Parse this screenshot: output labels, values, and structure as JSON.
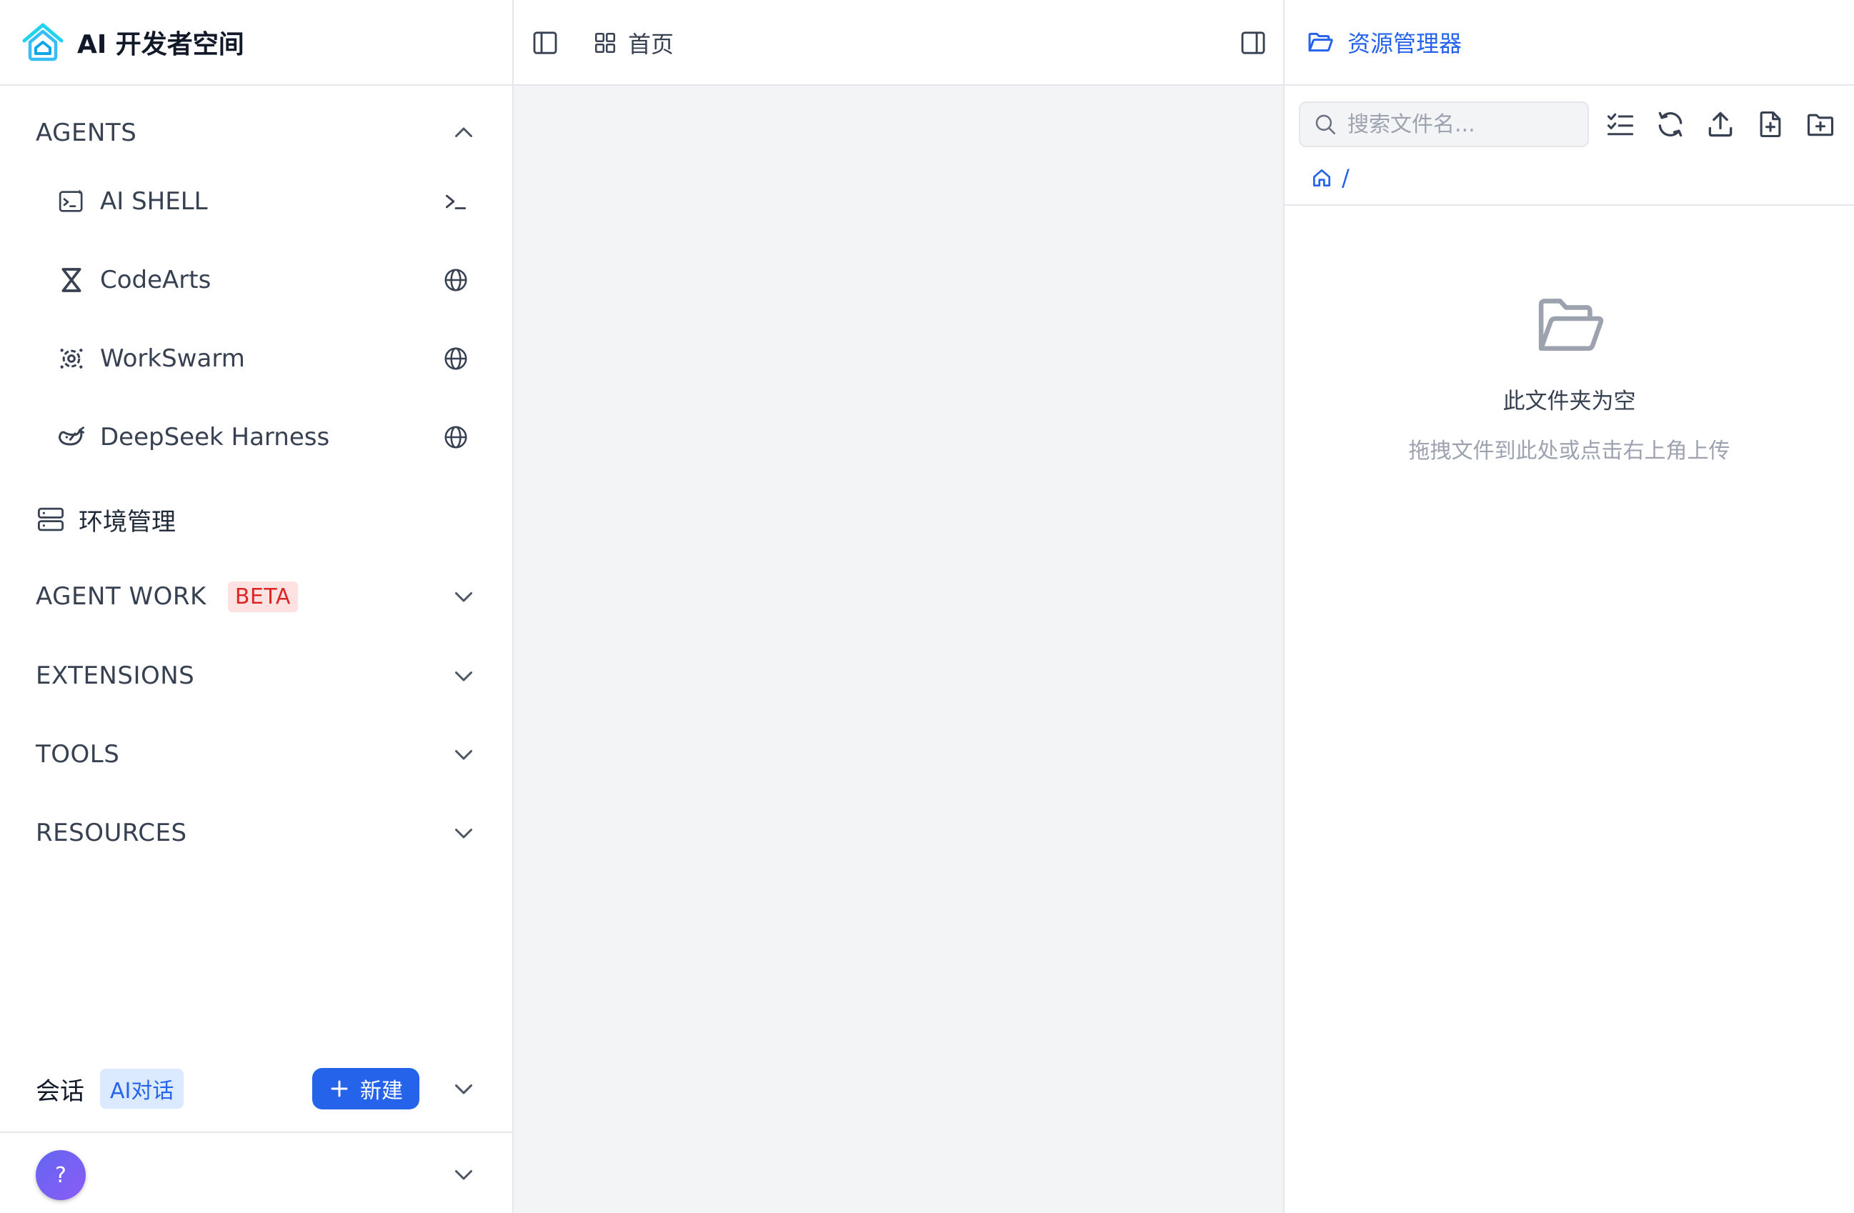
{
  "brand": {
    "title": "AI 开发者空间",
    "logo_icon": "house-layers-icon"
  },
  "sidebar": {
    "agents": {
      "title": "AGENTS",
      "items": [
        {
          "label": "AI SHELL",
          "icon": "terminal-sparkle-icon",
          "trailing_icon": "terminal-prompt-icon"
        },
        {
          "label": "CodeArts",
          "icon": "codearts-logo-icon",
          "trailing_icon": "globe-icon"
        },
        {
          "label": "WorkSwarm",
          "icon": "swarm-gear-icon",
          "trailing_icon": "globe-icon"
        },
        {
          "label": "DeepSeek Harness",
          "icon": "whale-icon",
          "trailing_icon": "globe-icon"
        }
      ]
    },
    "env": {
      "label": "环境管理",
      "icon": "server-icon"
    },
    "agent_work": {
      "title": "AGENT WORK",
      "badge": "BETA"
    },
    "extensions": {
      "title": "EXTENSIONS"
    },
    "tools": {
      "title": "TOOLS"
    },
    "resources": {
      "title": "RESOURCES"
    },
    "chat": {
      "title": "会话",
      "badge": "AI对话",
      "new_label": "新建"
    },
    "help": {
      "label": "?"
    }
  },
  "center": {
    "home_tab": "首页"
  },
  "explorer": {
    "title": "资源管理器",
    "search_placeholder": "搜索文件名...",
    "breadcrumb_sep": "/",
    "empty_title": "此文件夹为空",
    "empty_hint": "拖拽文件到此处或点击右上角上传"
  },
  "colors": {
    "accent": "#2563eb",
    "beta_text": "#dc2626",
    "beta_bg": "#fee2e2",
    "canvas": "#f3f4f6"
  }
}
